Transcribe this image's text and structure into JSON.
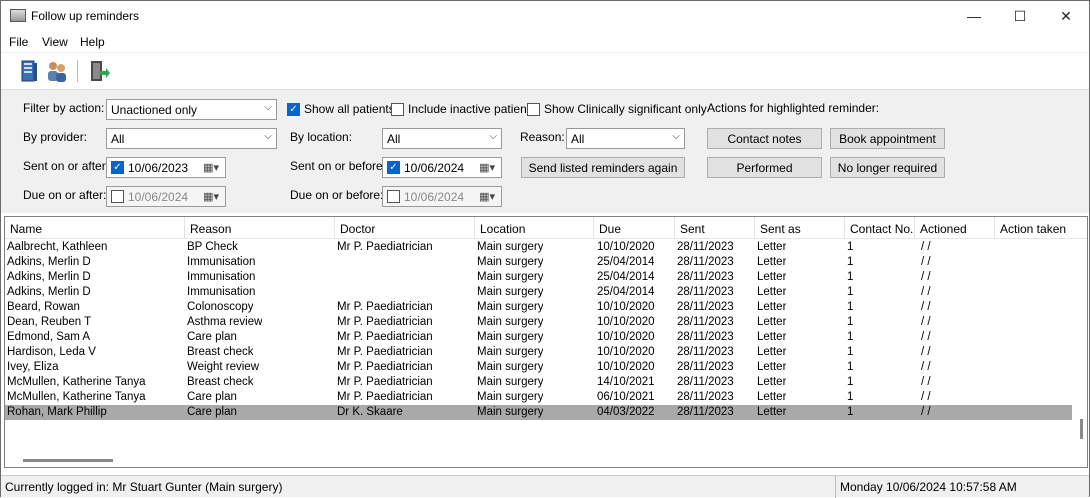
{
  "window": {
    "title": "Follow up reminders",
    "minimize": "—",
    "maximize": "☐",
    "close": "✕"
  },
  "menu": [
    "File",
    "View",
    "Help"
  ],
  "filters": {
    "filter_by_action_label": "Filter by action:",
    "filter_by_action_value": "Unactioned only",
    "show_all_patients": "Show all patients",
    "show_all_patients_checked": true,
    "include_inactive": "Include inactive patients",
    "include_inactive_checked": false,
    "show_clin_sig": "Show Clinically significant only",
    "show_clin_sig_checked": false,
    "by_provider_label": "By provider:",
    "by_provider_value": "All",
    "by_location_label": "By location:",
    "by_location_value": "All",
    "reason_label": "Reason:",
    "reason_value": "All",
    "sent_on_after_label": "Sent on or after:",
    "sent_on_after_value": "10/06/2023",
    "sent_on_after_checked": true,
    "sent_on_before_label": "Sent on or before:",
    "sent_on_before_value": "10/06/2024",
    "sent_on_before_checked": true,
    "due_on_after_label": "Due on or after:",
    "due_on_after_value": "10/06/2024",
    "due_on_after_checked": false,
    "due_on_before_label": "Due on or before:",
    "due_on_before_value": "10/06/2024",
    "due_on_before_checked": false,
    "send_again_button": "Send listed reminders again"
  },
  "actions": {
    "heading": "Actions for highlighted reminder:",
    "contact_notes": "Contact notes",
    "book_appointment": "Book appointment",
    "performed": "Performed",
    "no_longer_required": "No longer required"
  },
  "table": {
    "columns": [
      "Name",
      "Reason",
      "Doctor",
      "Location",
      "Due",
      "Sent",
      "Sent as",
      "Contact No.",
      "Actioned",
      "Action taken"
    ],
    "rows": [
      [
        "Aalbrecht, Kathleen",
        "BP Check",
        "Mr P. Paediatrician",
        "Main surgery",
        "10/10/2020",
        "28/11/2023",
        "Letter",
        "1",
        "/ /",
        ""
      ],
      [
        "Adkins, Merlin D",
        "Immunisation",
        "",
        "Main surgery",
        "25/04/2014",
        "28/11/2023",
        "Letter",
        "1",
        "/ /",
        ""
      ],
      [
        "Adkins, Merlin D",
        "Immunisation",
        "",
        "Main surgery",
        "25/04/2014",
        "28/11/2023",
        "Letter",
        "1",
        "/ /",
        ""
      ],
      [
        "Adkins, Merlin D",
        "Immunisation",
        "",
        "Main surgery",
        "25/04/2014",
        "28/11/2023",
        "Letter",
        "1",
        "/ /",
        ""
      ],
      [
        "Beard, Rowan",
        "Colonoscopy",
        "Mr P. Paediatrician",
        "Main surgery",
        "10/10/2020",
        "28/11/2023",
        "Letter",
        "1",
        "/ /",
        ""
      ],
      [
        "Dean, Reuben T",
        "Asthma review",
        "Mr P. Paediatrician",
        "Main surgery",
        "10/10/2020",
        "28/11/2023",
        "Letter",
        "1",
        "/ /",
        ""
      ],
      [
        "Edmond, Sam A",
        "Care plan",
        "Mr P. Paediatrician",
        "Main surgery",
        "10/10/2020",
        "28/11/2023",
        "Letter",
        "1",
        "/ /",
        ""
      ],
      [
        "Hardison, Leda V",
        "Breast check",
        "Mr P. Paediatrician",
        "Main surgery",
        "10/10/2020",
        "28/11/2023",
        "Letter",
        "1",
        "/ /",
        ""
      ],
      [
        "Ivey, Eliza",
        "Weight review",
        "Mr P. Paediatrician",
        "Main surgery",
        "10/10/2020",
        "28/11/2023",
        "Letter",
        "1",
        "/ /",
        ""
      ],
      [
        "McMullen, Katherine Tanya",
        "Breast check",
        "Mr P. Paediatrician",
        "Main surgery",
        "14/10/2021",
        "28/11/2023",
        "Letter",
        "1",
        "/ /",
        ""
      ],
      [
        "McMullen, Katherine Tanya",
        "Care plan",
        "Mr P. Paediatrician",
        "Main surgery",
        "06/10/2021",
        "28/11/2023",
        "Letter",
        "1",
        "/ /",
        ""
      ],
      [
        "Rohan, Mark Phillip",
        "Care plan",
        "Dr K. Skaare",
        "Main surgery",
        "04/03/2022",
        "28/11/2023",
        "Letter",
        "1",
        "/ /",
        ""
      ]
    ],
    "selected_row": 11
  },
  "status": {
    "logged_in": "Currently logged in:  Mr Stuart Gunter (Main surgery)",
    "datetime": "Monday 10/06/2024 10:57:58 AM"
  }
}
